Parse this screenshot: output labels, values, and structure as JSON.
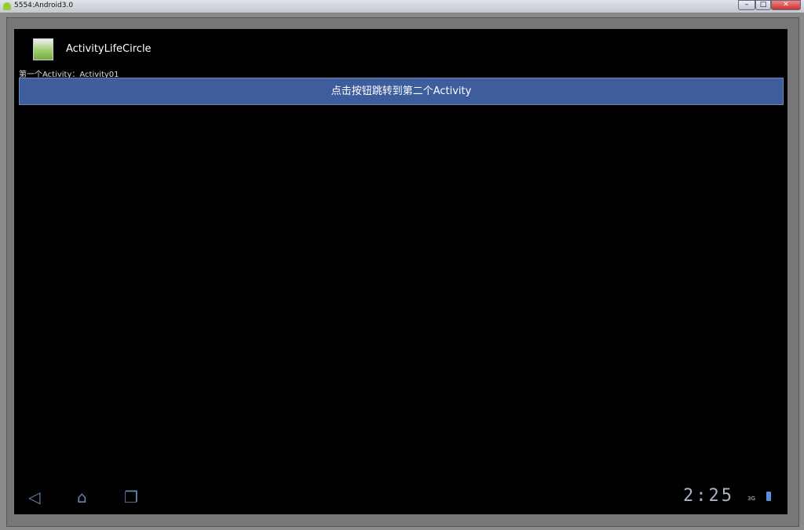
{
  "window": {
    "title": "5554:Android3.0",
    "min": "–",
    "max": "□",
    "close": "✕"
  },
  "app": {
    "title": "ActivityLifeCircle",
    "label": "第一个Activity：Activity01",
    "button": "点击按钮跳转到第二个Activity"
  },
  "statusbar": {
    "time": "2:25",
    "network": "3G"
  }
}
